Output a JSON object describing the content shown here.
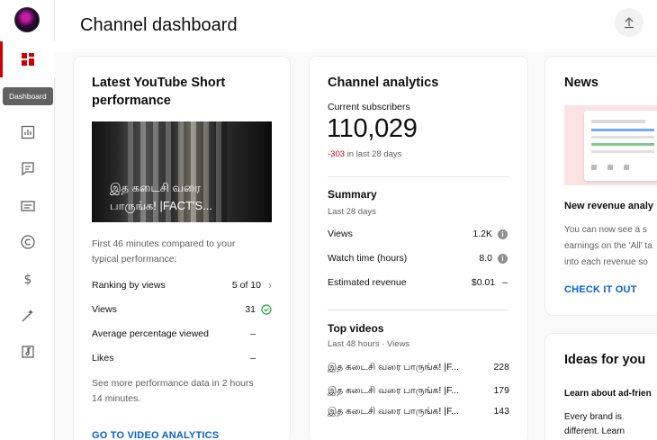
{
  "page": {
    "title": "Channel dashboard"
  },
  "sidebar": {
    "tooltip": "Dashboard",
    "items": [
      {
        "icon": "dashboard-icon"
      },
      {
        "icon": "analytics-icon"
      },
      {
        "icon": "comments-icon"
      },
      {
        "icon": "subtitles-icon"
      },
      {
        "icon": "copyright-icon"
      },
      {
        "icon": "earn-icon"
      },
      {
        "icon": "customization-icon"
      },
      {
        "icon": "audio-library-icon"
      }
    ]
  },
  "short_card": {
    "title_line1": "Latest YouTube Short",
    "title_line2": "performance",
    "thumb_caption_line1": "இத கடைசி வரை",
    "thumb_caption_line2": "பாருங்க! |FACT'S...",
    "compare_line1": "First 46 minutes compared to your",
    "compare_line2": "typical performance:",
    "ranking_label": "Ranking by views",
    "ranking_value": "5 of 10",
    "views_label": "Views",
    "views_value": "31",
    "avg_label": "Average percentage viewed",
    "avg_value": "–",
    "likes_label": "Likes",
    "likes_value": "–",
    "more_line1": "See more performance data in 2 hours",
    "more_line2": "14 minutes.",
    "link": "GO TO VIDEO ANALYTICS"
  },
  "analytics_card": {
    "title": "Channel analytics",
    "subs_label": "Current subscribers",
    "subs_value": "110,029",
    "subs_change": "-303",
    "subs_change_suffix": " in last 28 days",
    "summary_title": "Summary",
    "summary_period": "Last 28 days",
    "rows": [
      {
        "label": "Views",
        "value": "1.2K"
      },
      {
        "label": "Watch time (hours)",
        "value": "8.0"
      },
      {
        "label": "Estimated revenue",
        "value": "$0.01",
        "extra": "–"
      }
    ],
    "top_title": "Top videos",
    "top_period": "Last 48 hours · Views",
    "videos": [
      {
        "title": "இத கடைசி வரை பாருங்க! |F...",
        "views": "228"
      },
      {
        "title": "இத கடைசி வரை பாருங்க! |F...",
        "views": "179"
      },
      {
        "title": "இத கடைசி வரை பாருங்க! |F...",
        "views": "143"
      }
    ]
  },
  "news_card": {
    "title": "News",
    "headline": "New revenue analy",
    "body_line1": "You can now see a s",
    "body_line2": "earnings on the 'All' ta",
    "body_line3": "into each revenue so",
    "link": "CHECK IT OUT"
  },
  "ideas_card": {
    "title": "Ideas for you",
    "subtitle": "Learn about ad-frien",
    "body_line1": "Every brand is",
    "body_line2": "different. Learn"
  },
  "colors": {
    "accent_red": "#cc0000",
    "link_blue": "#065fd4",
    "negative": "#c00",
    "success": "#2ba640"
  }
}
